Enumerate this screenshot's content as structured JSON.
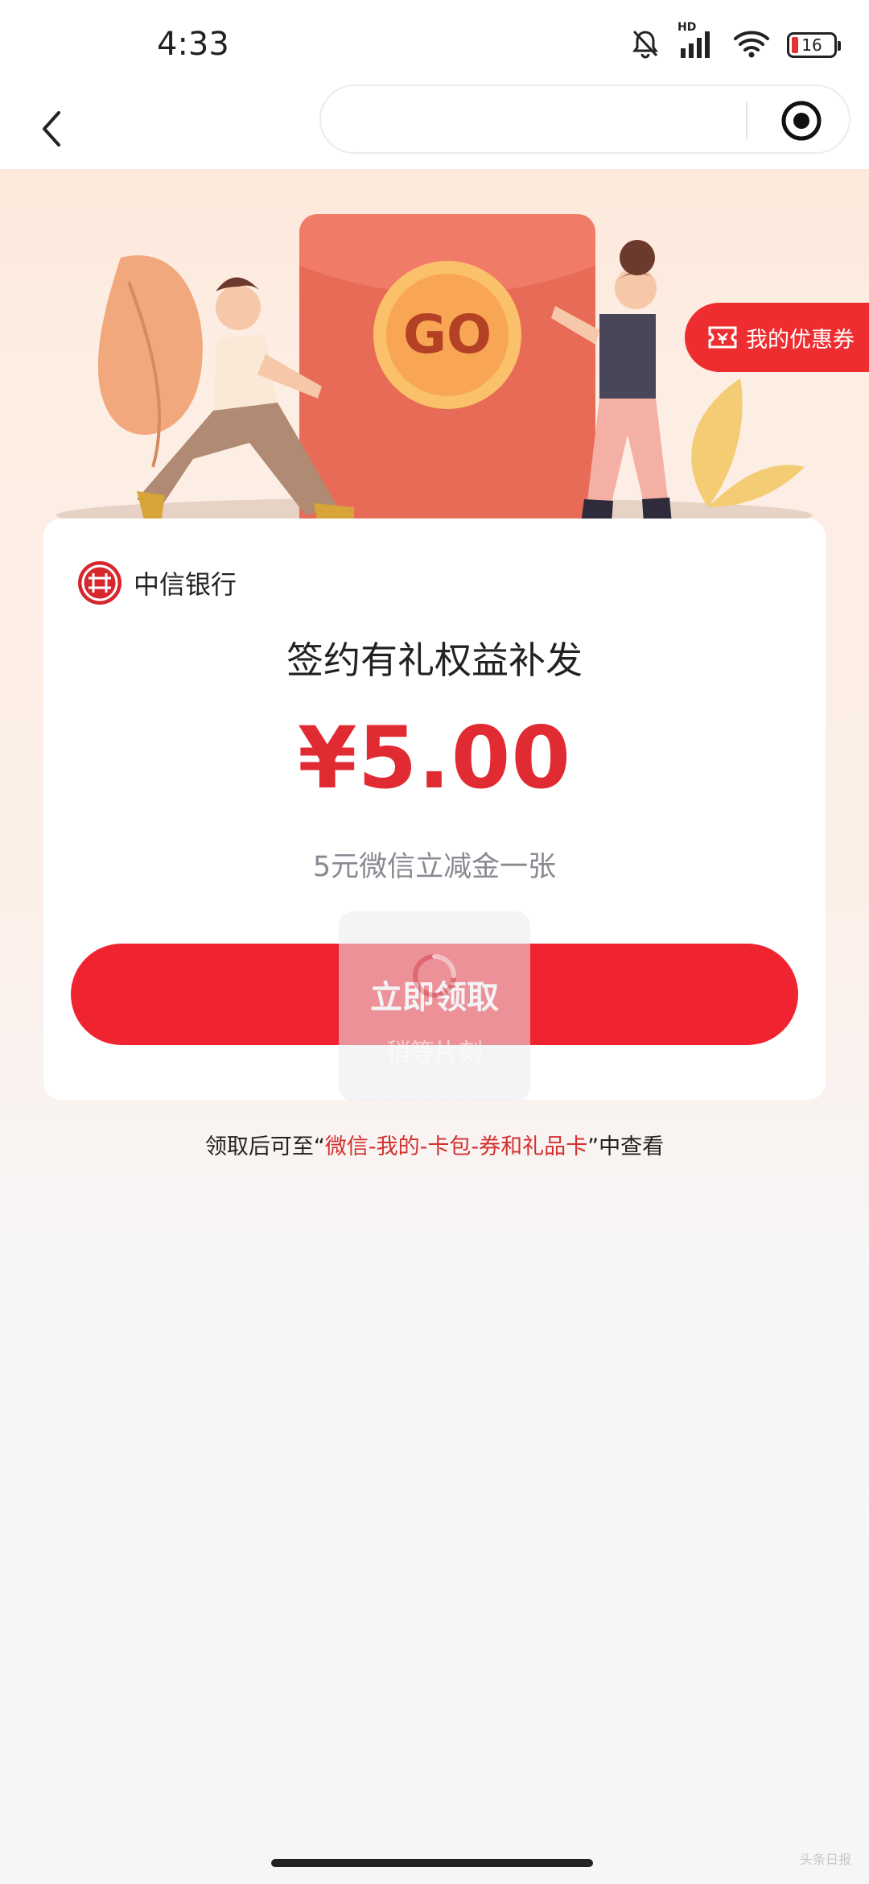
{
  "status_bar": {
    "time": "4:33",
    "network_label": "HD",
    "battery": "16",
    "battery_fill": 0.16
  },
  "nav": {
    "back_icon": "chevron-left-icon",
    "capsule_icon": "target-icon"
  },
  "coupon_tab": {
    "label": "我的优惠券",
    "icon": "ticket-icon"
  },
  "card": {
    "bank_name": "中信银行",
    "title": "签约有礼权益补发",
    "amount": "¥5.00",
    "description": "5元微信立减金一张",
    "claim_button": "立即领取"
  },
  "loading_toast": {
    "text": "稍等片刻"
  },
  "hint": {
    "prefix": "领取后可至“",
    "link": "微信-我的-卡包-券和礼品卡",
    "suffix": "”中查看"
  },
  "watermark": "头条日报",
  "colors": {
    "accent_red": "#f02430",
    "amount_red": "#e12b33",
    "link_red": "#d3302f"
  }
}
